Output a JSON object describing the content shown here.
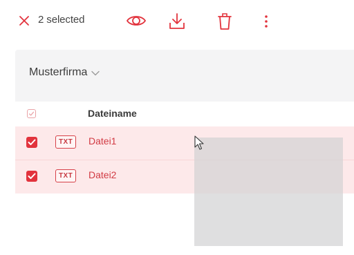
{
  "toolbar": {
    "selection_count": "2 selected",
    "icons": [
      "close-icon",
      "eye-icon",
      "download-icon",
      "trash-icon",
      "more-vert-icon"
    ]
  },
  "panel": {
    "company": "Musterfirma",
    "column_header": "Dateiname",
    "files": [
      {
        "type": "TXT",
        "name": "Datei1",
        "selected": true
      },
      {
        "type": "TXT",
        "name": "Datei2",
        "selected": true
      }
    ]
  },
  "colors": {
    "accent": "#e2333d",
    "selected_row": "#fde9ea",
    "panel_bg": "#f4f4f5"
  }
}
